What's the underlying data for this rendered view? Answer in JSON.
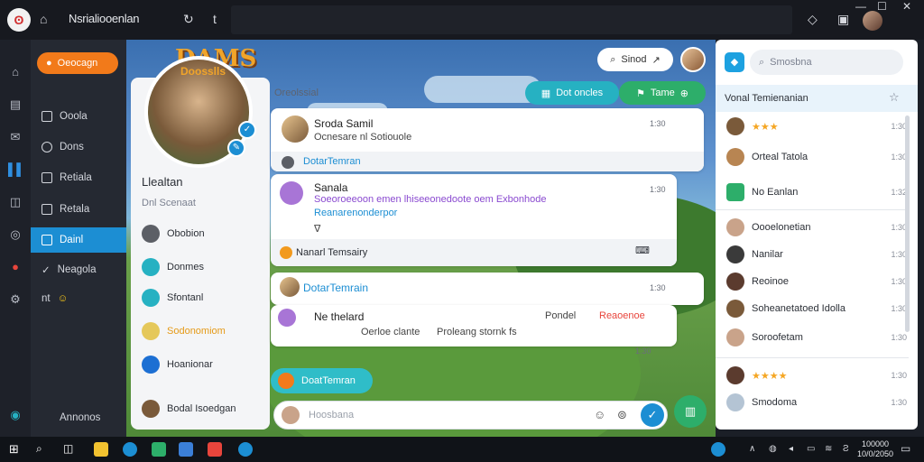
{
  "window": {
    "title": "Nsrialiooenlan",
    "tb_tab_icon": "t"
  },
  "sidebar": {
    "new_button": "Oeocagn",
    "items": [
      {
        "label": "Ooola",
        "icon": "list-icon"
      },
      {
        "label": "Dons",
        "icon": "info-icon"
      },
      {
        "label": "Retiala",
        "icon": "grid-icon"
      },
      {
        "label": "Retala",
        "icon": "doc-icon"
      },
      {
        "label": "Dainl",
        "icon": "chat-icon",
        "active": true
      },
      {
        "label": "Neagola",
        "icon": "check-icon"
      },
      {
        "label": "nt",
        "icon": "smile-icon"
      }
    ],
    "bottom_label": "Annonos"
  },
  "scene": {
    "logo_text": "DAMS",
    "photo_text": "Doosslls"
  },
  "profile": {
    "name": "Llealtan",
    "subtitle": "Dnl Scenaat",
    "items": [
      {
        "label": "Obobion",
        "color": "#5c5f66"
      },
      {
        "label": "Donmes",
        "color": "#26b1c2"
      },
      {
        "label": "Sfontanl",
        "color": "#26b1c2"
      },
      {
        "label": "Sodonomiom",
        "color": "#e59a17"
      },
      {
        "label": "Hoanionar",
        "color": "#1c6fd3"
      },
      {
        "label": "Bodal Isoedgan",
        "color": "#7a5a3a"
      }
    ]
  },
  "chat": {
    "header_label": "Oreolssial",
    "pill_left": "Dot oncles",
    "pill_right": "Tame",
    "search_pill": "Sinod",
    "messages": [
      {
        "name": "Sroda Samil",
        "text": "Ocnesare nl Sotiouole",
        "time": "1:30"
      },
      {
        "strip": "DotarTemran"
      },
      {
        "name": "Sanala",
        "text": "Soeoroeeoon emen lhiseeonedoote oem Exbonhode",
        "text2": "Reanarenonderpor",
        "time": "1:30"
      },
      {
        "strip_name": "Nanarl Temsairy"
      },
      {
        "name": "DotarTemrain",
        "time": "1:30"
      },
      {
        "name": "Ne thelard",
        "text": "Oerloe clante",
        "text3": "Proleang stornk fs",
        "right": "Pondel",
        "right2": "Reaoenoe",
        "time": "1:30"
      }
    ],
    "chip": "DoatTemran",
    "composer_placeholder": "Hoosbana"
  },
  "right_panel": {
    "search_placeholder": "Smosbna",
    "heading": "Vonal Temienanian",
    "items": [
      {
        "label": "★★★",
        "time": "1:30",
        "avatar": "#7a5a3a"
      },
      {
        "label": "Orteal Tatola",
        "time": "1:30",
        "avatar": "#b88552"
      },
      {
        "label": "No Eanlan",
        "time": "1:32",
        "avatar": "#2dae6a"
      },
      {
        "label": "Oooelonetian",
        "time": "1:30",
        "avatar": "#c9a38a"
      },
      {
        "label": "Nanilar",
        "time": "1:30",
        "avatar": "#3a3a3a"
      },
      {
        "label": "Reoinoe",
        "time": "1:30",
        "avatar": "#5b3b2e"
      },
      {
        "label": "Soheanetatoed Idolla",
        "time": "1:30",
        "avatar": "#7a5a3a"
      },
      {
        "label": "Soroofetam",
        "time": "1:30",
        "avatar": "#c9a38a"
      },
      {
        "label": "★★★★",
        "time": "1:30",
        "avatar": "#5b3b2e"
      },
      {
        "label": "Smodoma",
        "time": "1:30",
        "avatar": "#b4c4d4"
      }
    ]
  },
  "taskbar": {
    "time": "100000",
    "date": "10/0/2050"
  }
}
